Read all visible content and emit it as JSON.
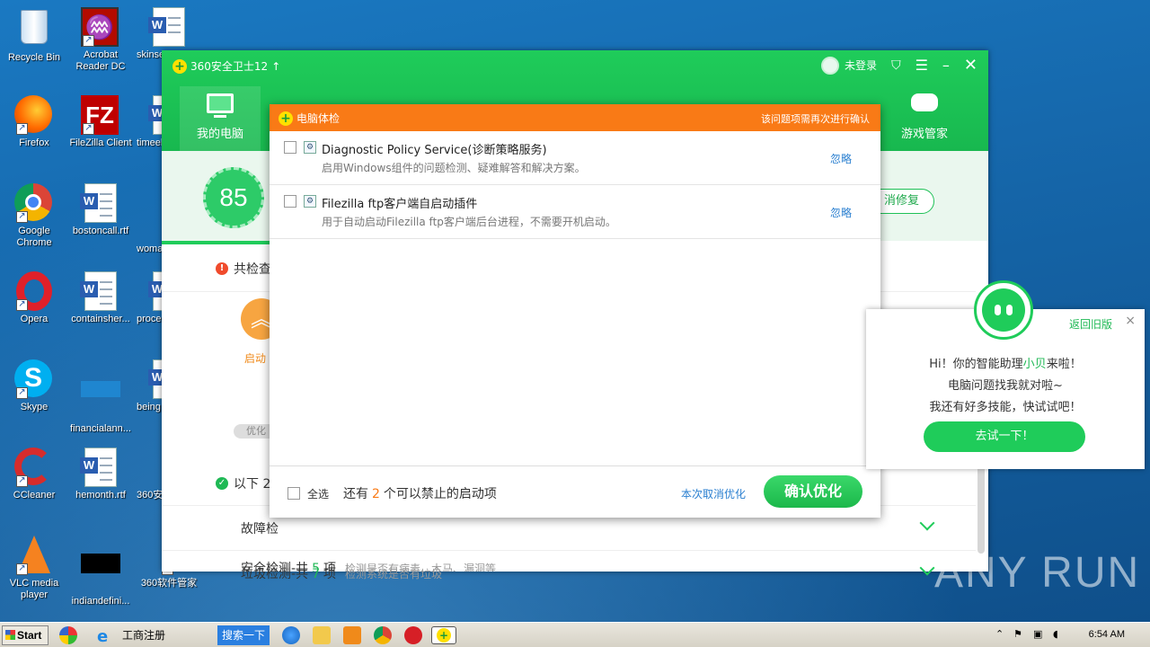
{
  "desktop": {
    "icons": [
      {
        "label": "Recycle Bin"
      },
      {
        "label": "Acrobat Reader DC"
      },
      {
        "label": "skinse"
      },
      {
        "label": "Firefox"
      },
      {
        "label": "FileZilla Client"
      },
      {
        "label": "timeel"
      },
      {
        "label": "Google Chrome"
      },
      {
        "label": "bostoncall.rtf"
      },
      {
        "label": "woma"
      },
      {
        "label": "Opera"
      },
      {
        "label": "containsher..."
      },
      {
        "label": "proce"
      },
      {
        "label": "Skype"
      },
      {
        "label": "financialann..."
      },
      {
        "label": "being"
      },
      {
        "label": "CCleaner"
      },
      {
        "label": "hemonth.rtf"
      },
      {
        "label": "360安"
      },
      {
        "label": "VLC media player"
      },
      {
        "label": "indiandefini..."
      },
      {
        "label": "360软件管家"
      }
    ]
  },
  "app": {
    "title": "360安全卫士12",
    "login": "未登录",
    "tabs": [
      {
        "label": "我的电脑"
      },
      {
        "label": "游戏管家"
      }
    ],
    "score": "85",
    "fix_button": "一键修复",
    "fix_visible": "消修复",
    "warn_text": "共检查",
    "boost_label": "启动",
    "boost_pill": "优化",
    "ok_text": "以下 2",
    "categories": [
      {
        "name": "故障检",
        "count": "",
        "desc": ""
      },
      {
        "name": "垃圾检测-共",
        "count": "7",
        "unit": "项",
        "desc": "检测系统是否有垃圾"
      },
      {
        "name": "安全检测-共",
        "count": "5",
        "unit": "项",
        "desc": "检测是否有病毒、木马、漏洞等"
      }
    ]
  },
  "dialog": {
    "title": "电脑体检",
    "hint": "该问题项需再次进行确认",
    "items": [
      {
        "name": "Diagnostic Policy Service(诊断策略服务)",
        "desc": "启用Windows组件的问题检测、疑难解答和解决方案。",
        "action": "忽略"
      },
      {
        "name": "Filezilla ftp客户端自启动插件",
        "desc": "用于自动启动Filezilla ftp客户端后台进程，不需要开机启动。",
        "action": "忽略"
      }
    ],
    "footer": {
      "select_all": "全选",
      "remain_prefix": "还有",
      "remain_count": "2",
      "remain_suffix": "个可以禁止的启动项",
      "cancel": "本次取消优化",
      "confirm": "确认优化"
    }
  },
  "assistant": {
    "back": "返回旧版",
    "close": "×",
    "line1_a": "Hi！你的智能助理",
    "line1_name": "小贝",
    "line1_b": "来啦！",
    "line2": "电脑问题找我就对啦~",
    "line3": "我还有好多技能，快试试吧！",
    "button": "去试一下！"
  },
  "watermark": "ANY RUN",
  "taskbar": {
    "start": "Start",
    "ie_item": "工商注册",
    "search_btn": "搜索一下",
    "clock": "6:54 AM"
  }
}
